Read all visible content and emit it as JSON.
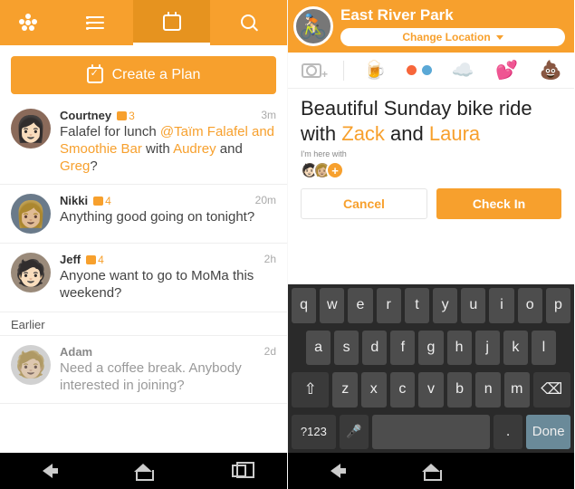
{
  "left": {
    "tabs": [
      "list",
      "calendar",
      "search"
    ],
    "active_tab": 1,
    "create_button": "Create a Plan",
    "items": [
      {
        "name": "Courtney",
        "comments": "3",
        "time": "3m",
        "msg_pre": "Falafel for lunch ",
        "mention1": "@Taïm Falafel and Smoothie Bar",
        "msg_mid": " with ",
        "mention2": "Audrey",
        "msg_mid2": " and ",
        "mention3": "Greg",
        "msg_post": "?"
      },
      {
        "name": "Nikki",
        "comments": "4",
        "time": "20m",
        "msg": "Anything good going on tonight?"
      },
      {
        "name": "Jeff",
        "comments": "4",
        "time": "2h",
        "msg": "Anyone want to go to MoMa this weekend?"
      }
    ],
    "section_label": "Earlier",
    "earlier": [
      {
        "name": "Adam",
        "time": "2d",
        "msg": "Need a coffee break. Anybody interested in joining?"
      }
    ]
  },
  "right": {
    "location_title": "East River Park",
    "change_location": "Change Location",
    "compose_pre": "Beautiful Sunday bike ride with ",
    "mention1": "Zack",
    "compose_mid": " and ",
    "mention2": "Laura",
    "here_with_label": "I'm here with",
    "cancel": "Cancel",
    "checkin": "Check In",
    "keys_r1": [
      "q",
      "w",
      "e",
      "r",
      "t",
      "y",
      "u",
      "i",
      "o",
      "p"
    ],
    "keys_r2": [
      "a",
      "s",
      "d",
      "f",
      "g",
      "h",
      "j",
      "k",
      "l"
    ],
    "keys_r3": [
      "z",
      "x",
      "c",
      "v",
      "b",
      "n",
      "m"
    ],
    "key_shift": "⇧",
    "key_bksp": "⌫",
    "key_sym": "?123",
    "key_mic": "🎤",
    "key_space": "",
    "key_period": ".",
    "key_done": "Done"
  },
  "colors": {
    "accent": "#f7a02d"
  }
}
